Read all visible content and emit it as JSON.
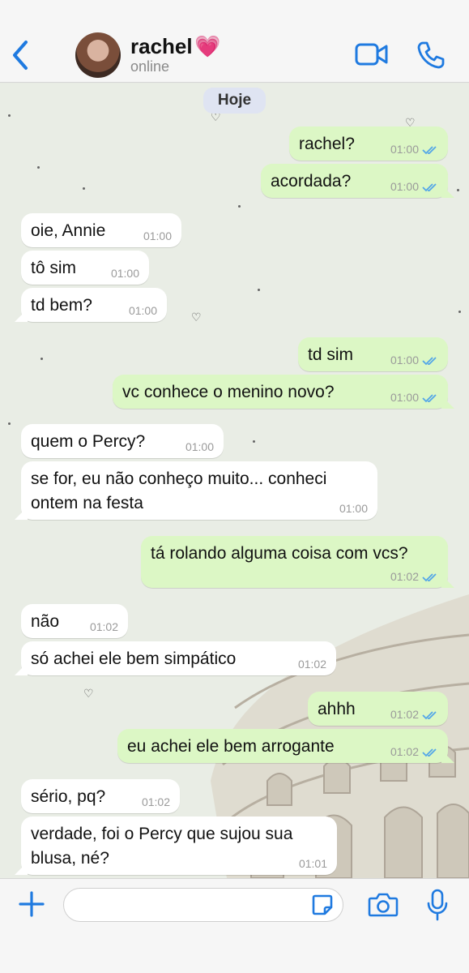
{
  "header": {
    "contact_name": "rachel",
    "contact_emoji": "💗",
    "status": "online",
    "icons": [
      "back-chevron-icon",
      "video-camera-icon",
      "phone-icon"
    ]
  },
  "chat": {
    "day_label": "Hoje",
    "messages": [
      {
        "dir": "out",
        "text": "rachel?",
        "time": "01:00",
        "read": true
      },
      {
        "dir": "out",
        "text": "acordada?",
        "time": "01:00",
        "read": true
      },
      {
        "dir": "in",
        "text": "oie, Annie",
        "time": "01:00"
      },
      {
        "dir": "in",
        "text": "tô sim",
        "time": "01:00"
      },
      {
        "dir": "in",
        "text": "td bem?",
        "time": "01:00"
      },
      {
        "dir": "out",
        "text": "td sim",
        "time": "01:00",
        "read": true
      },
      {
        "dir": "out",
        "text": "vc conhece o menino novo?",
        "time": "01:00",
        "read": true
      },
      {
        "dir": "in",
        "text": "quem o Percy?",
        "time": "01:00"
      },
      {
        "dir": "in",
        "text_line1": "se for, eu não conheço muito... conheci",
        "text_line2": "ontem na festa",
        "time": "01:00"
      },
      {
        "dir": "out",
        "text": "tá rolando alguma coisa com vcs?",
        "time": "01:02",
        "read": true
      },
      {
        "dir": "in",
        "text": "não",
        "time": "01:02"
      },
      {
        "dir": "in",
        "text": "só achei ele bem simpático",
        "time": "01:02"
      },
      {
        "dir": "out",
        "text": "ahhh",
        "time": "01:02",
        "read": true
      },
      {
        "dir": "out",
        "text": "eu achei ele bem arrogante",
        "time": "01:02",
        "read": true
      },
      {
        "dir": "in",
        "text": "sério, pq?",
        "time": "01:02"
      },
      {
        "dir": "in",
        "text_line1": "verdade, foi o Percy que sujou sua",
        "text_line2": "blusa, né?",
        "time": "01:01"
      }
    ]
  },
  "composer": {
    "placeholder": "",
    "icons": [
      "plus-icon",
      "sticker-icon",
      "camera-icon",
      "microphone-icon"
    ]
  },
  "colors": {
    "accent": "#1f7ae0",
    "outgoing_bubble": "#dcf7c5",
    "incoming_bubble": "#ffffff",
    "read_ticks": "#53a6e8",
    "heart": "#e0479e"
  }
}
